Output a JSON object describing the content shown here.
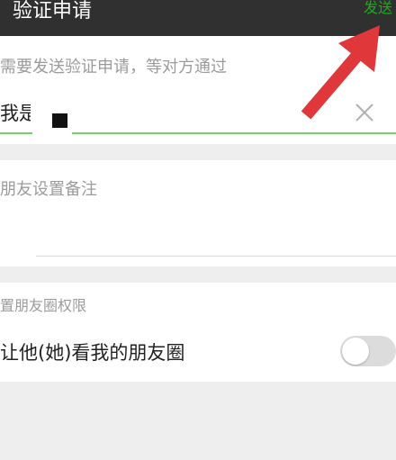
{
  "header": {
    "title": "验证申请",
    "send_label": "发送"
  },
  "request_section": {
    "hint": "需要发送验证申请，等对方通过",
    "message_value": "我是i",
    "clear_icon": "close-icon"
  },
  "remark_section": {
    "hint": "朋友设置备注",
    "remark_value": ""
  },
  "moments_section": {
    "hint": "置朋友圈权限",
    "row_label": "让他(她)看我的朋友圈",
    "toggle_on": false
  },
  "colors": {
    "accent": "#1aad19",
    "topbar": "#303030",
    "arrow": "#e0383a"
  }
}
